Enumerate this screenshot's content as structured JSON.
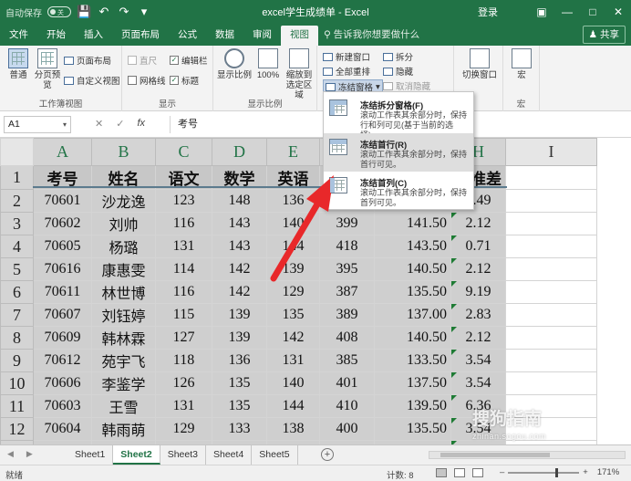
{
  "titlebar": {
    "autosave_label": "自动保存",
    "autosave_state": "关",
    "title": "excel学生成绩单 - Excel",
    "login": "登录"
  },
  "tabs": [
    "文件",
    "开始",
    "插入",
    "页面布局",
    "公式",
    "数据",
    "审阅",
    "视图"
  ],
  "active_tab": "视图",
  "tell_me": "告诉我你想要做什么",
  "share": "共享",
  "ribbon": {
    "views_group": {
      "normal": "普通",
      "page_break": "分页预览",
      "page_layout": "页面布局",
      "custom_views": "自定义视图",
      "label": "工作簿视图"
    },
    "show_group": {
      "ruler": "直尺",
      "formula_bar": "编辑栏",
      "gridlines": "网格线",
      "headings": "标题",
      "label": "显示"
    },
    "zoom_group": {
      "zoom": "显示比例",
      "hundred": "100%",
      "zoom_to_selection": "缩放到选定区域",
      "label": "显示比例"
    },
    "window_group": {
      "new_window": "新建窗口",
      "arrange_all": "全部重排",
      "freeze_panes": "冻结窗格",
      "split": "拆分",
      "hide": "隐藏",
      "unhide": "取消隐藏",
      "switch_windows": "切换窗口"
    },
    "macros_group": {
      "macros": "宏",
      "label": "宏"
    }
  },
  "formula_bar": {
    "name_box": "A1",
    "content": "考号"
  },
  "columns": [
    "A",
    "B",
    "C",
    "D",
    "E",
    "F",
    "G",
    "H",
    "I"
  ],
  "headers": [
    "考号",
    "姓名",
    "语文",
    "数学",
    "英语",
    "",
    "",
    "标准差"
  ],
  "rows": [
    {
      "n": "2",
      "id": "70601",
      "name": "沙龙逸",
      "yw": "123",
      "sx": "148",
      "yy": "136",
      "f": "",
      "g": "",
      "h": "3.49"
    },
    {
      "n": "3",
      "id": "70602",
      "name": "刘帅",
      "yw": "116",
      "sx": "143",
      "yy": "140",
      "f": "399",
      "g": "141.50",
      "h": "2.12"
    },
    {
      "n": "4",
      "id": "70605",
      "name": "杨璐",
      "yw": "131",
      "sx": "143",
      "yy": "144",
      "f": "418",
      "g": "143.50",
      "h": "0.71"
    },
    {
      "n": "5",
      "id": "70616",
      "name": "康惠雯",
      "yw": "114",
      "sx": "142",
      "yy": "139",
      "f": "395",
      "g": "140.50",
      "h": "2.12"
    },
    {
      "n": "6",
      "id": "70611",
      "name": "林世博",
      "yw": "116",
      "sx": "142",
      "yy": "129",
      "f": "387",
      "g": "135.50",
      "h": "9.19"
    },
    {
      "n": "7",
      "id": "70607",
      "name": "刘钰婷",
      "yw": "115",
      "sx": "139",
      "yy": "135",
      "f": "389",
      "g": "137.00",
      "h": "2.83"
    },
    {
      "n": "8",
      "id": "70609",
      "name": "韩林霖",
      "yw": "127",
      "sx": "139",
      "yy": "142",
      "f": "408",
      "g": "140.50",
      "h": "2.12"
    },
    {
      "n": "9",
      "id": "70612",
      "name": "苑宇飞",
      "yw": "118",
      "sx": "136",
      "yy": "131",
      "f": "385",
      "g": "133.50",
      "h": "3.54"
    },
    {
      "n": "10",
      "id": "70606",
      "name": "李鉴学",
      "yw": "126",
      "sx": "135",
      "yy": "140",
      "f": "401",
      "g": "137.50",
      "h": "3.54"
    },
    {
      "n": "11",
      "id": "70603",
      "name": "王雪",
      "yw": "131",
      "sx": "135",
      "yy": "144",
      "f": "410",
      "g": "139.50",
      "h": "6.36"
    },
    {
      "n": "12",
      "id": "70604",
      "name": "韩雨萌",
      "yw": "129",
      "sx": "133",
      "yy": "138",
      "f": "400",
      "g": "135.50",
      "h": "3.54"
    },
    {
      "n": "13",
      "id": "70621",
      "name": "张希",
      "yw": "123",
      "sx": "130",
      "yy": "134",
      "f": "387",
      "g": "132.00",
      "h": "2.83"
    }
  ],
  "dropdown": {
    "freeze_panes_title": "冻结拆分窗格(F)",
    "freeze_panes_desc": "滚动工作表其余部分时，保持行和列可见(基于当前的选择)。",
    "freeze_top_row_title": "冻结首行(R)",
    "freeze_top_row_desc": "滚动工作表其余部分时，保持首行可见。",
    "freeze_first_col_title": "冻结首列(C)",
    "freeze_first_col_desc": "滚动工作表其余部分时，保持首列可见。"
  },
  "sheets": [
    "Sheet1",
    "Sheet2",
    "Sheet3",
    "Sheet4",
    "Sheet5"
  ],
  "active_sheet": "Sheet2",
  "status": {
    "ready": "就绪",
    "count": "计数: 8",
    "zoom": "171%"
  },
  "watermark": {
    "main": "搜狗指南",
    "sub": "zhinan.sogou.com"
  },
  "colors": {
    "excel_green": "#217346",
    "selection_gray": "#cfcfcf",
    "arrow_red": "#e8282a"
  }
}
